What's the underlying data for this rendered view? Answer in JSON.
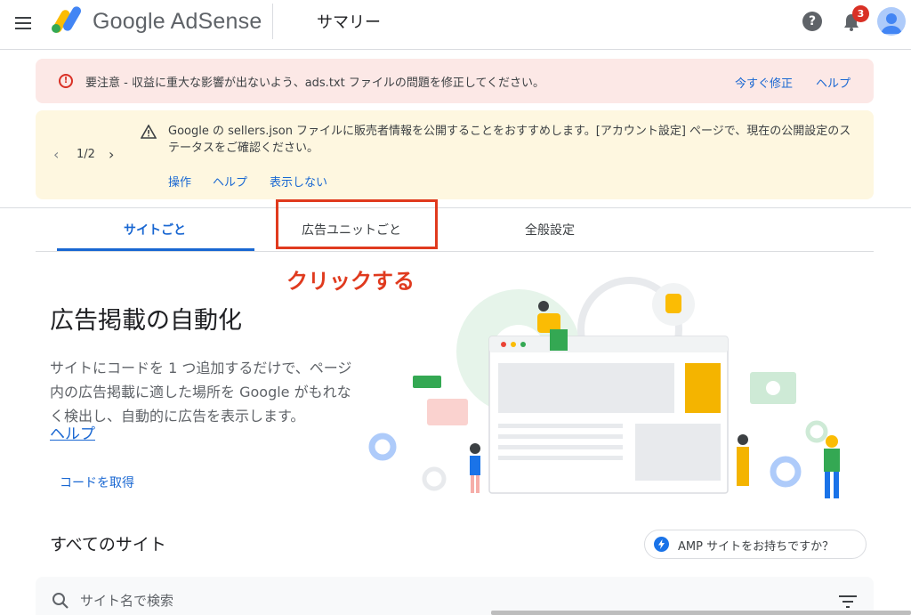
{
  "header": {
    "brand": "Google AdSense",
    "page_title": "サマリー",
    "help_glyph": "?",
    "notification_count": "3"
  },
  "alerts": {
    "error": {
      "text": "要注意 - 収益に重大な影響が出ないよう、ads.txt ファイルの問題を修正してください。",
      "action_fix": "今すぐ修正",
      "action_help": "ヘルプ"
    },
    "warning": {
      "pager": "1/2",
      "text": "Google の sellers.json ファイルに販売者情報を公開することをおすすめします。[アカウント設定] ページで、現在の公開設定のステータスをご確認ください。",
      "action_operate": "操作",
      "action_help": "ヘルプ",
      "action_dismiss": "表示しない"
    }
  },
  "tabs": [
    {
      "label": "サイトごと",
      "active": true
    },
    {
      "label": "広告ユニットごと",
      "active": false
    },
    {
      "label": "全般設定",
      "active": false
    }
  ],
  "annotation": "クリックする",
  "main": {
    "heading": "広告掲載の自動化",
    "description": "サイトにコードを 1 つ追加するだけで、ページ内の広告掲載に適した場所を Google がもれなく検出し、自動的に広告を表示します。",
    "help_link": "ヘルプ",
    "get_code": "コードを取得"
  },
  "sites": {
    "heading": "すべてのサイト",
    "amp_button": "AMP サイトをお持ちですか？",
    "search_placeholder": "サイト名で検索"
  },
  "colors": {
    "accent": "#1967d2",
    "error_bg": "#fce8e6",
    "warning_bg": "#fef7e0",
    "annotation": "#e03a1e"
  },
  "icons": [
    "menu-icon",
    "adsense-logo",
    "help-icon",
    "bell-icon",
    "avatar",
    "error-icon",
    "warning-icon",
    "chevron-left-icon",
    "chevron-right-icon",
    "bolt-icon",
    "search-icon",
    "filter-icon"
  ]
}
